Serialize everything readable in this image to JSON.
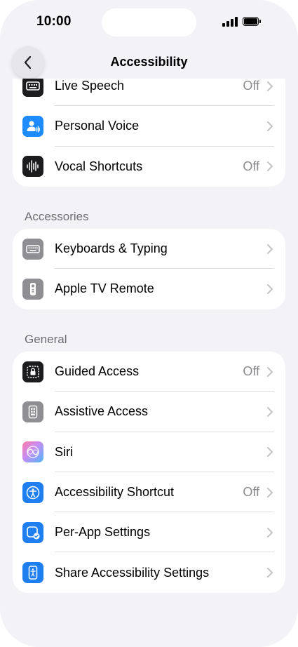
{
  "status": {
    "time": "10:00"
  },
  "nav": {
    "title": "Accessibility"
  },
  "groups": [
    {
      "header": "",
      "rows": [
        {
          "label": "Live Speech",
          "value": "Off",
          "icon": "keyboard-speech-icon",
          "color": "#1c1c1e"
        },
        {
          "label": "Personal Voice",
          "value": "",
          "icon": "personal-voice-icon",
          "color": "#1e8cff"
        },
        {
          "label": "Vocal Shortcuts",
          "value": "Off",
          "icon": "waveform-icon",
          "color": "#1c1c1e"
        }
      ]
    },
    {
      "header": "Accessories",
      "rows": [
        {
          "label": "Keyboards & Typing",
          "value": "",
          "icon": "keyboard-icon",
          "color": "#8e8e93"
        },
        {
          "label": "Apple TV Remote",
          "value": "",
          "icon": "remote-icon",
          "color": "#8e8e93"
        }
      ]
    },
    {
      "header": "General",
      "rows": [
        {
          "label": "Guided Access",
          "value": "Off",
          "icon": "lock-icon",
          "color": "#1c1c1e"
        },
        {
          "label": "Assistive Access",
          "value": "",
          "icon": "assistive-access-icon",
          "color": "#8e8e93"
        },
        {
          "label": "Siri",
          "value": "",
          "icon": "siri-icon",
          "color": "#c58df5"
        },
        {
          "label": "Accessibility Shortcut",
          "value": "Off",
          "icon": "accessibility-icon",
          "color": "#1f7ff0"
        },
        {
          "label": "Per-App Settings",
          "value": "",
          "icon": "per-app-icon",
          "color": "#1f7ff0"
        },
        {
          "label": "Share Accessibility Settings",
          "value": "",
          "icon": "share-settings-icon",
          "color": "#1f7ff0"
        }
      ]
    }
  ]
}
